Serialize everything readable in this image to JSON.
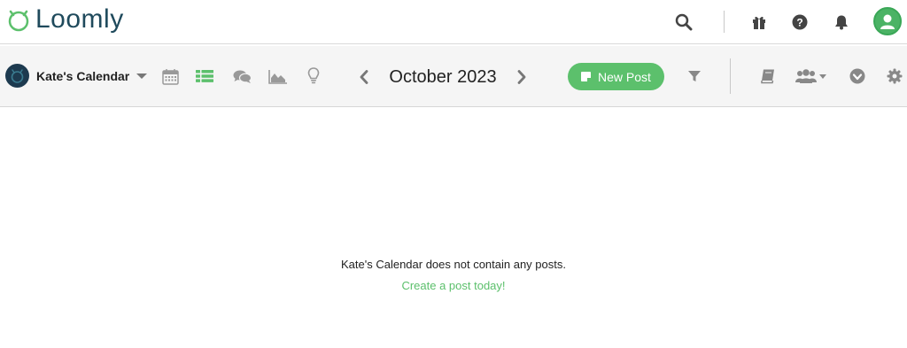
{
  "app": {
    "logo_text": "Loomly",
    "brand_color": "#5cc06c",
    "logo_color": "#1f4a5c"
  },
  "topbar": {
    "icons": [
      "search-icon",
      "gift-icon",
      "help-icon",
      "bell-icon",
      "user-avatar"
    ]
  },
  "toolbar": {
    "calendar_name": "Kate's Calendar",
    "view_icons": [
      "calendar-grid-icon",
      "list-view-icon",
      "comments-icon",
      "analytics-icon",
      "ideas-lightbulb-icon"
    ],
    "active_view": "list-view-icon",
    "month_label": "October 2023",
    "new_post_label": "New Post",
    "right_icons": [
      "filter-icon",
      "library-book-icon",
      "team-users-icon",
      "download-icon",
      "settings-gear-icon"
    ]
  },
  "main": {
    "empty_message": "Kate's Calendar does not contain any posts.",
    "empty_link": "Create a post today!"
  }
}
